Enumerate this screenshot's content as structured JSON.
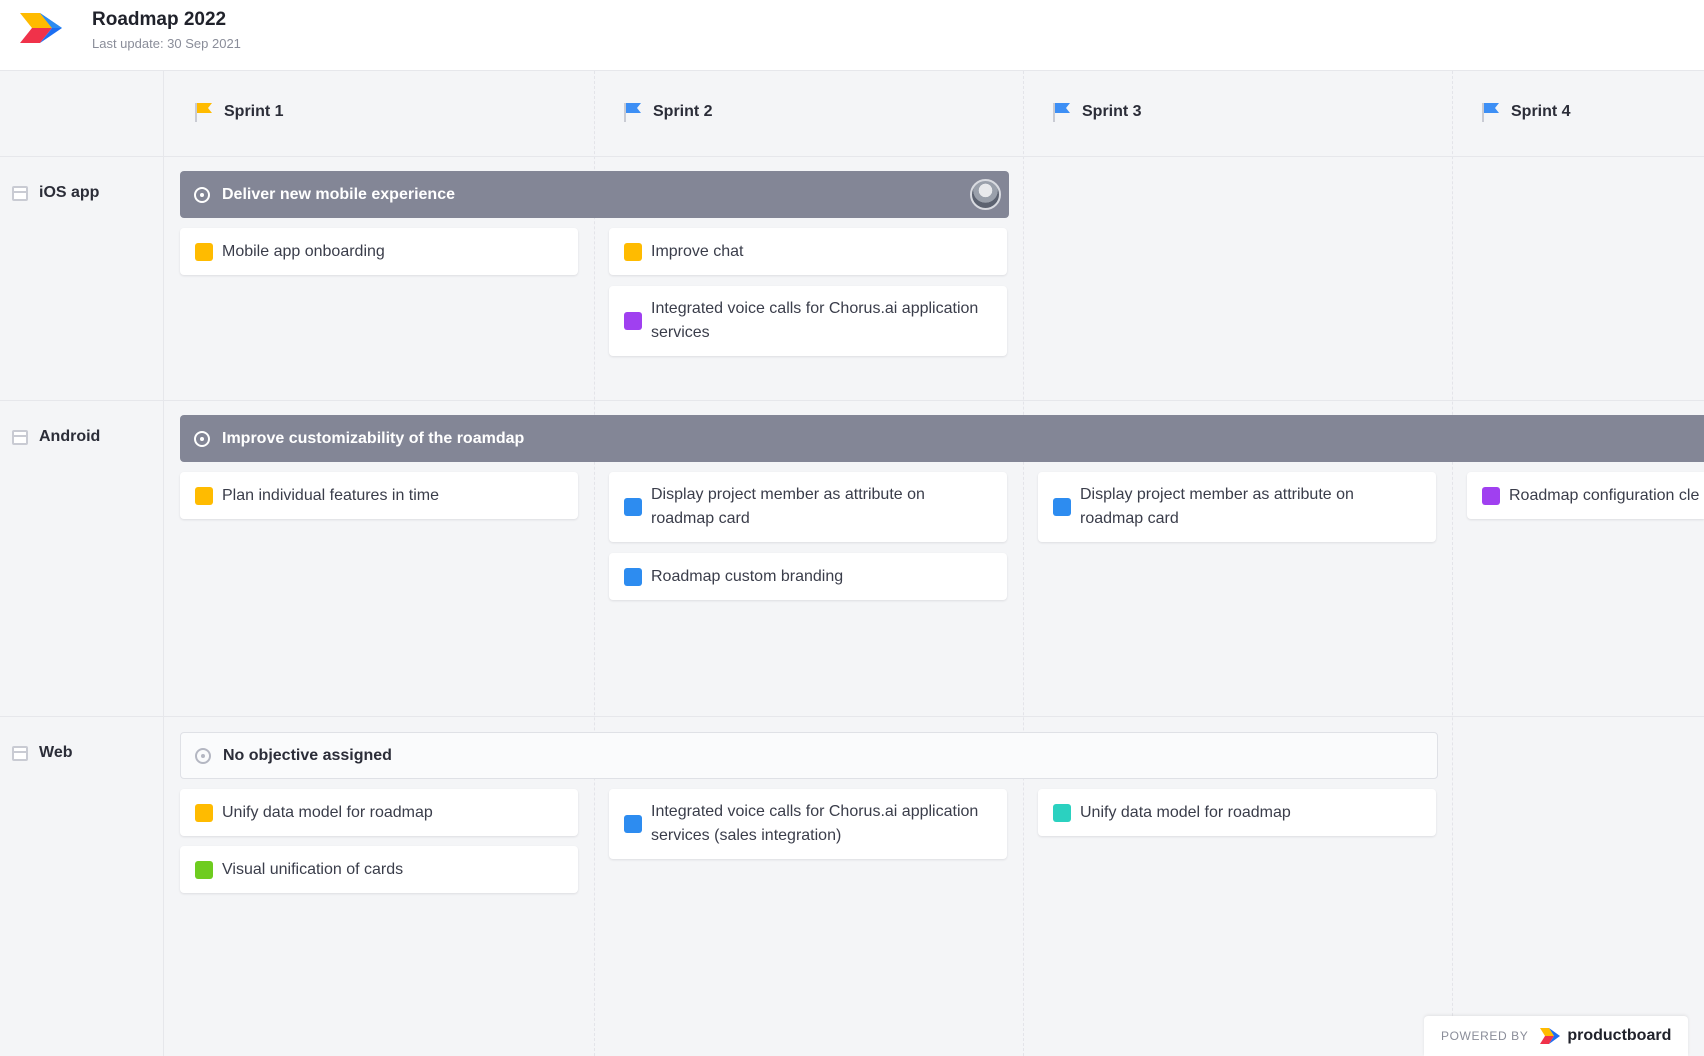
{
  "header": {
    "title": "Roadmap 2022",
    "last_update": "Last update: 30 Sep 2021"
  },
  "colors": {
    "yellow": "#ffbb00",
    "blue": "#2d8cf0",
    "purple": "#a040f0",
    "green": "#6ecc1f",
    "teal": "#2bd1c0",
    "objective": "#838696"
  },
  "sprints": [
    {
      "label": "Sprint 1",
      "flag_color": "#ffbb00"
    },
    {
      "label": "Sprint 2",
      "flag_color": "#3d8ff5"
    },
    {
      "label": "Sprint 3",
      "flag_color": "#3d8ff5"
    },
    {
      "label": "Sprint 4",
      "flag_color": "#3d8ff5"
    }
  ],
  "lanes": [
    {
      "label": "iOS app"
    },
    {
      "label": "Android"
    },
    {
      "label": "Web"
    }
  ],
  "objectives": {
    "ios": "Deliver new mobile experience",
    "android": "Improve customizability of the roamdap",
    "web": "No objective assigned"
  },
  "cards": {
    "ios_s1_1": {
      "text": "Mobile app onboarding",
      "color": "yellow"
    },
    "ios_s2_1": {
      "text": "Improve chat",
      "color": "yellow"
    },
    "ios_s2_2": {
      "text": "Integrated voice calls for Chorus.ai application services",
      "color": "purple"
    },
    "android_s1_1": {
      "text": "Plan individual features in time",
      "color": "yellow"
    },
    "android_s2_1": {
      "text": "Display project member as attribute on roadmap card",
      "color": "blue"
    },
    "android_s2_2": {
      "text": "Roadmap custom branding",
      "color": "blue"
    },
    "android_s3_1": {
      "text": "Display project member as attribute on roadmap card",
      "color": "blue"
    },
    "android_s4_1": {
      "text": "Roadmap configuration cle",
      "color": "purple"
    },
    "web_s1_1": {
      "text": "Unify data model for roadmap",
      "color": "yellow"
    },
    "web_s1_2": {
      "text": "Visual unification of cards",
      "color": "green"
    },
    "web_s2_1": {
      "text": "Integrated voice calls for Chorus.ai application services (sales integration)",
      "color": "blue"
    },
    "web_s3_1": {
      "text": "Unify data model for roadmap",
      "color": "teal"
    }
  },
  "footer": {
    "powered_by": "POWERED BY",
    "brand": "productboard"
  }
}
